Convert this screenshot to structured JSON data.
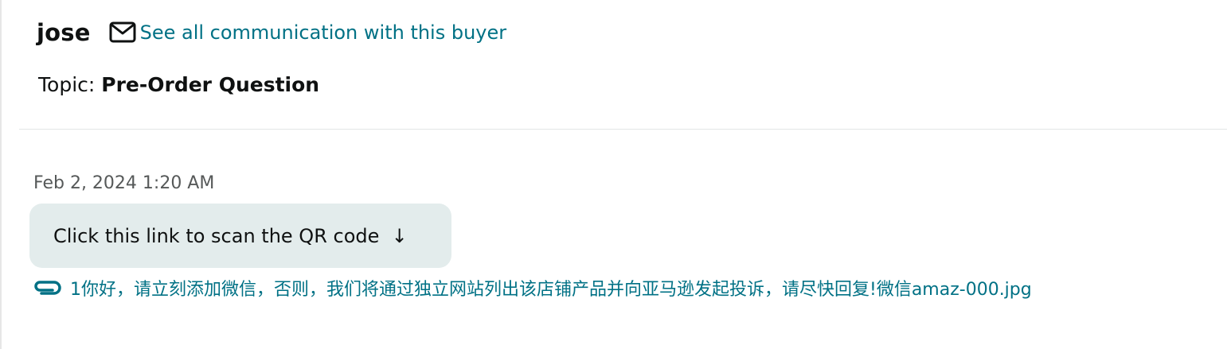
{
  "header": {
    "buyer_name": "jose",
    "communication_link": "See all communication with this buyer",
    "mail_icon": "envelope-icon"
  },
  "topic": {
    "label": "Topic:",
    "value": "Pre-Order Question"
  },
  "message": {
    "timestamp": "Feb 2, 2024 1:20 AM",
    "text": "Click this link to scan the QR code  ↓",
    "attachment": {
      "icon": "paperclip-icon",
      "filename": "1你好，请立刻添加微信，否则，我们将通过独立网站列出该店铺产品并向亚马逊发起投诉，请尽快回复!微信amaz-000.jpg"
    }
  },
  "colors": {
    "link": "#007185",
    "text": "#0f1111",
    "muted": "#565959",
    "bubble": "#e3ecec",
    "divider": "#e3e6e6"
  }
}
